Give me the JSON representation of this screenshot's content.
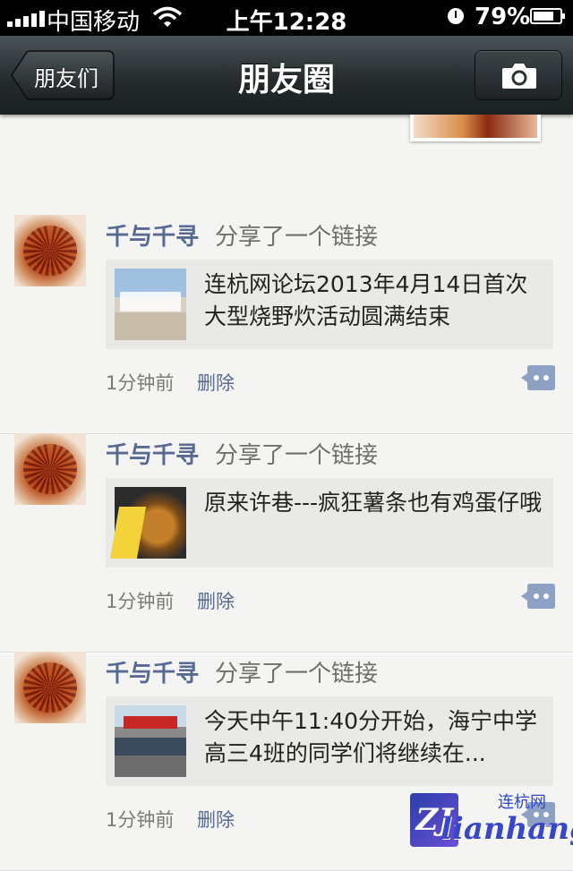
{
  "status_bar": {
    "carrier": "中国移动",
    "time": "上午12:28",
    "battery": "79%"
  },
  "nav": {
    "back_label": "朋友们",
    "title": "朋友圈",
    "camera_icon": "camera-icon"
  },
  "posts": [
    {
      "user": "千与千寻",
      "action": "分享了一个链接",
      "link_text": "连杭网论坛2013年4月14日首次大型烧野炊活动圆满结束",
      "time": "1分钟前",
      "delete_label": "删除"
    },
    {
      "user": "千与千寻",
      "action": "分享了一个链接",
      "link_text": "原来许巷---疯狂薯条也有鸡蛋仔哦",
      "time": "1分钟前",
      "delete_label": "删除"
    },
    {
      "user": "千与千寻",
      "action": "分享了一个链接",
      "link_text": "今天中午11:40分开始，海宁中学高三4班的同学们将继续在...",
      "time": "1分钟前",
      "delete_label": "删除"
    }
  ],
  "watermark": {
    "logo": "ZJ",
    "cn": "连杭网",
    "en": "lianhang"
  },
  "colors": {
    "username": "#586a93",
    "nav_bg": "#262c2e",
    "page_bg": "#f4f4f2"
  }
}
